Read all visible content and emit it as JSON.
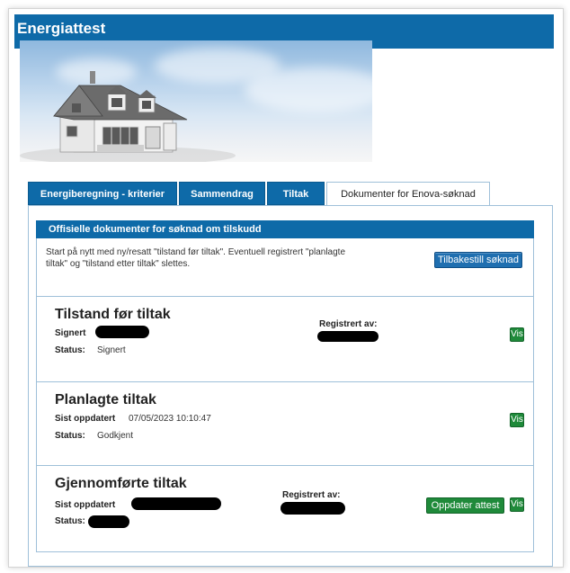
{
  "app": {
    "title": "Energiattest"
  },
  "tabs": [
    {
      "label": "Energiberegning - kriterier",
      "active": false
    },
    {
      "label": "Sammendrag",
      "active": false
    },
    {
      "label": "Tiltak",
      "active": false
    },
    {
      "label": "Dokumenter for Enova-søknad",
      "active": true
    }
  ],
  "documents": {
    "header": "Offisielle dokumenter for søknad om tilskudd",
    "intro_line1": "Start på nytt med ny/resatt \"tilstand før tiltak\". Eventuell registrert \"planlagte",
    "intro_line2": "tiltak\" og \"tilstand etter tiltak\" slettes.",
    "reset_button": "Tilbakestill søknad"
  },
  "cards": [
    {
      "title": "Tilstand før tiltak",
      "row1_label": "Signert",
      "status_label": "Status:",
      "status_value": "Signert",
      "registered_label": "Registrert av:",
      "view_button": "Vis"
    },
    {
      "title": "Planlagte tiltak",
      "row1_label": "Sist oppdatert",
      "row1_value": "07/05/2023 10:10:47",
      "status_label": "Status:",
      "status_value": "Godkjent",
      "view_button": "Vis"
    },
    {
      "title": "Gjennomførte tiltak",
      "row1_label": "Sist oppdatert",
      "status_label": "Status:",
      "registered_label": "Registrert av:",
      "update_button": "Oppdater attest",
      "view_button": "Vis"
    }
  ],
  "colors": {
    "brand_blue": "#0e6aa8",
    "action_green": "#1f8a3a"
  },
  "icons": {
    "banner": "house-illustration"
  }
}
